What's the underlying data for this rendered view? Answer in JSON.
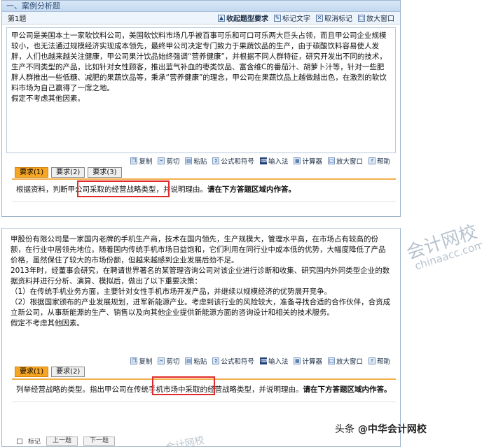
{
  "section_header": "一、案例分析题",
  "question_bar": {
    "number": "第1题",
    "tools": [
      "收起题型要求",
      "标记文字",
      "取消标记",
      "放大窗口"
    ]
  },
  "q1": {
    "stem": [
      "甲公司是美国本土一家软饮料公司，美国软饮料市场几乎被百事可乐和可口可乐两大巨头占领，而且甲公司企业规模较小，也无法通过规模经济实现成本领先，最终甲公司决定专门致力于果蔬饮品的生产，由于碳酸饮料容易使人发胖，人们也越来越关注健康，甲公司果汁饮品始终强调“营养健康”，并根据不同人群特征，研究开发出不同的技术，生产不同类型的产品，比如针对女性顾客，推出蓝气补血的枣类饮品、富含维C的番茄汁、胡萝卜汁等，针对一些肥胖人群推出一些低糖、减肥的果蔬饮品等，秉承“营养健康”的理念，甲公司在果蔬饮品上越做越出色，在激烈的软饮料市场为自己赢得了一席之地。",
      "假定不考虑其他因素。"
    ],
    "toolbar": [
      "复制",
      "剪切",
      "粘贴",
      "公式和符号",
      "输入法",
      "计算器",
      "放大窗口",
      "帮助"
    ],
    "tabs": [
      "要求(1)",
      "要求(2)",
      "要求(3)"
    ],
    "requirement_plain": "根据资料，判断甲公司采取的经营战略类型，并说明理由。",
    "requirement_bold": "请在下方答题区域内作答。"
  },
  "q2": {
    "stem": [
      "甲股份有限公司是一家国内老牌的手机生产商，技术在国内领先，生产规模大，管理水平高，在市场占有较高的份额，在行业中居领先地位。随着国内传统手机市场日益饱和，它们利用在同行业中成本低的优势，大幅度降低了产品价格，虽然保住了较大的市场份额，但越来越感到企业发展后劲不足。",
      "2013年时，经董事会研究，在聘请世界著名的某管理咨询公司对该企业进行诊断和收集、研究国内外同类型企业的数据资料并进行分析、演算、模拟后，做出了以下重要决策：",
      "（1）在传统手机业务方面，主要针对女性手机市场开发产品，并继续以规模经济的优势展开竞争。",
      "（2）根据国家颁布的产业发展规划，进军新能源产业。考虑到该行业的风险较大，准备寻找合适的合作伙伴，合资成立新公司，从事新能源的生产、销售以及向其他企业提供新能源方面的咨询设计和相关的技术服务。",
      "假定不考虑其他因素。"
    ],
    "toolbar": [
      "复制",
      "剪切",
      "粘贴",
      "公式和符号",
      "输入法",
      "计算器",
      "放大窗口",
      "帮助"
    ],
    "tabs": [
      "要求(1)",
      "要求(2)"
    ],
    "requirement_plain": "列举经营战略的类型。指出甲公司在传统手机市场中采取的经营战略类型，并说明理由。",
    "requirement_bold": "请在下方答题区域内作答。"
  },
  "footer": {
    "mark": "标记",
    "prev": "上一题",
    "next": "下一题"
  },
  "watermark": {
    "line1": "会计网校",
    "line2": "chinaacc.com"
  },
  "credit": {
    "prefix": "头条",
    "handle": "@中华会计网校"
  },
  "colors": {
    "header_bg": "#d9e8f7",
    "tab_active": "#f6a623",
    "highlight_box": "#e02b2b"
  }
}
